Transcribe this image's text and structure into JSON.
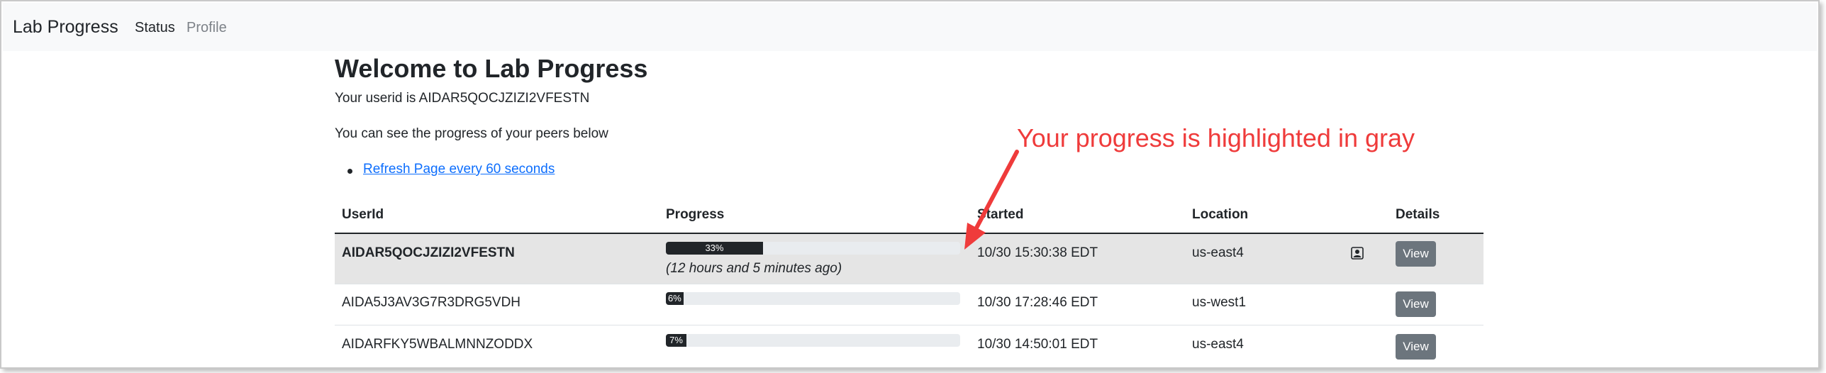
{
  "navbar": {
    "brand": "Lab Progress",
    "items": [
      {
        "label": "Status",
        "active": true
      },
      {
        "label": "Profile",
        "active": false
      }
    ]
  },
  "main": {
    "title": "Welcome to Lab Progress",
    "userid_text": "Your userid is AIDAR5QOCJZIZI2VFESTN",
    "peers_text": "You can see the progress of your peers below",
    "refresh_link": "Refresh Page every 60 seconds"
  },
  "table": {
    "columns": [
      "UserId",
      "Progress",
      "Started",
      "Location",
      "Details"
    ],
    "rows": [
      {
        "userid": "AIDAR5QOCJZIZI2VFESTN",
        "progress_pct": 33,
        "progress_label": "33%",
        "ago": "(12 hours and 5 minutes ago)",
        "started": "10/30 15:30:38 EDT",
        "location": "us-east4",
        "details_label": "View",
        "highlighted": true,
        "icon": "person-badge-icon"
      },
      {
        "userid": "AIDA5J3AV3G7R3DRG5VDH",
        "progress_pct": 6,
        "progress_label": "6%",
        "started": "10/30 17:28:46 EDT",
        "location": "us-west1",
        "details_label": "View",
        "highlighted": false
      },
      {
        "userid": "AIDARFKY5WBALMNNZODDX",
        "progress_pct": 7,
        "progress_label": "7%",
        "started": "10/30 14:50:01 EDT",
        "location": "us-east4",
        "details_label": "View",
        "highlighted": false
      }
    ]
  },
  "annotation": {
    "text": "Your progress is highlighted in gray",
    "color": "#ef3b3b"
  },
  "colors": {
    "navbar_bg": "#f8f9fa",
    "highlight_row": "#e5e5e5",
    "progress_fill": "#212529",
    "link": "#0d6efd",
    "button": "#6c757d"
  }
}
